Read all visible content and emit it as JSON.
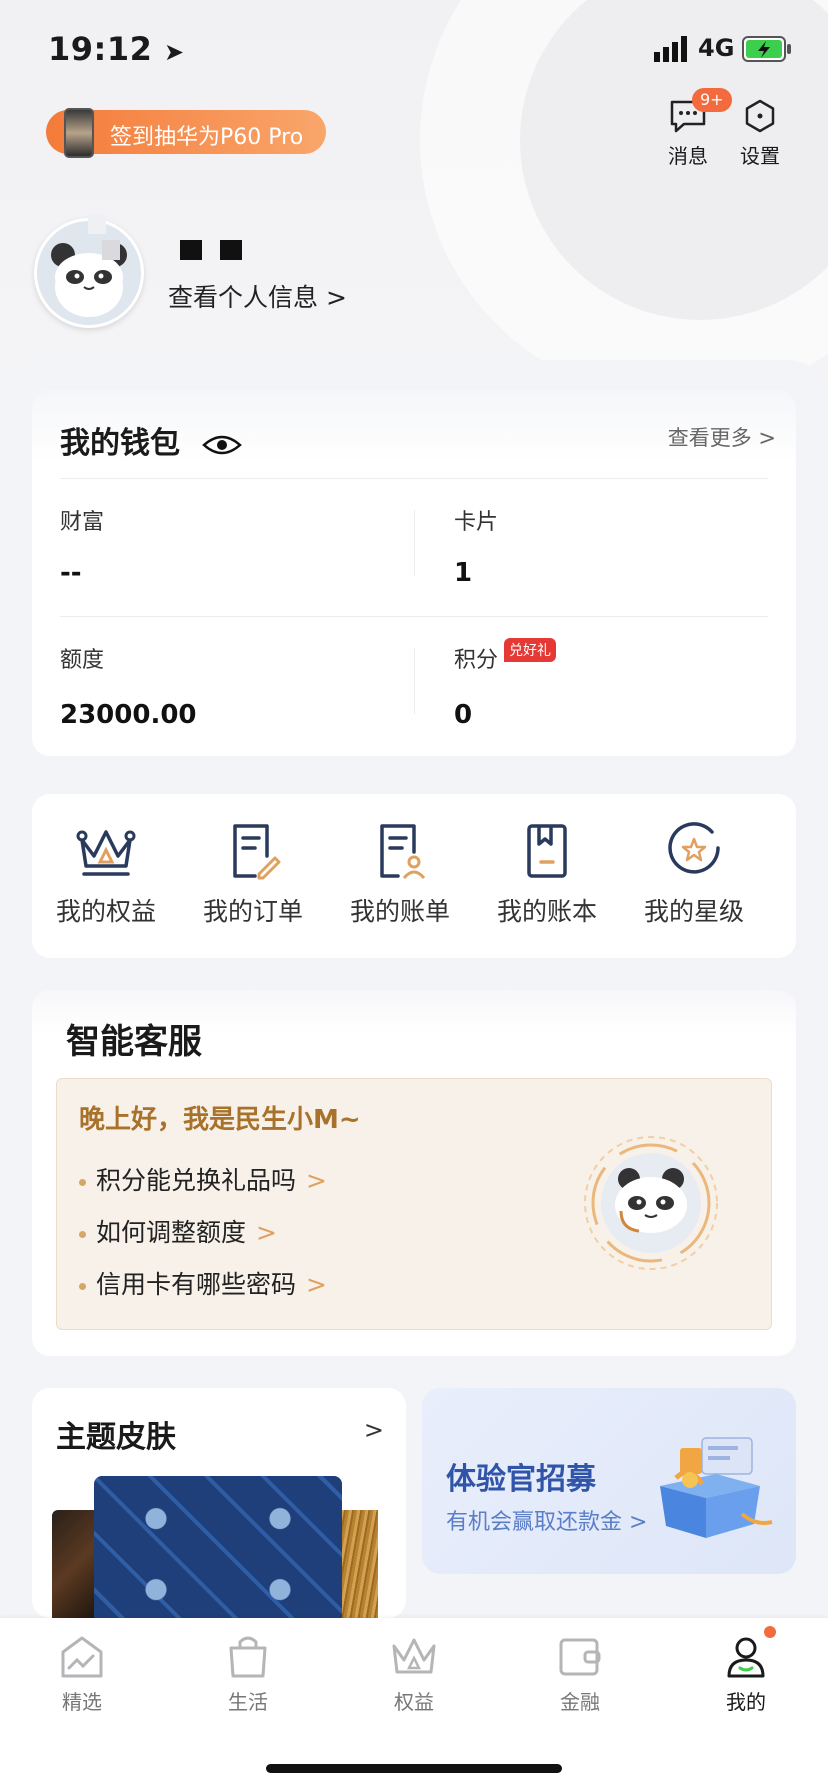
{
  "status_bar": {
    "time": "19:12",
    "network": "4G"
  },
  "promo": {
    "label": "签到抽华为P60 Pro"
  },
  "header": {
    "messages_label": "消息",
    "messages_badge": "9+",
    "settings_label": "设置",
    "view_profile": "查看个人信息 >"
  },
  "wallet": {
    "title": "我的钱包",
    "more": "查看更多 >",
    "items": [
      {
        "label": "财富",
        "value": "--"
      },
      {
        "label": "卡片",
        "value": "1"
      },
      {
        "label": "额度",
        "value": "23000.00"
      },
      {
        "label": "积分",
        "value": "0",
        "badge": "兑好礼"
      }
    ]
  },
  "quick_links": [
    {
      "label": "我的权益",
      "icon": "crown-icon"
    },
    {
      "label": "我的订单",
      "icon": "order-icon"
    },
    {
      "label": "我的账单",
      "icon": "bill-icon"
    },
    {
      "label": "我的账本",
      "icon": "ledger-icon"
    },
    {
      "label": "我的星级",
      "icon": "star-level-icon"
    }
  ],
  "service": {
    "title": "智能客服",
    "greeting": "晚上好，我是民生小M~",
    "questions": [
      "积分能兑换礼品吗",
      "如何调整额度",
      "信用卡有哪些密码"
    ]
  },
  "skin": {
    "title": "主题皮肤",
    "arrow": ">"
  },
  "recruit": {
    "title": "体验官招募",
    "subtitle": "有机会赢取还款金 >"
  },
  "tabs": [
    {
      "label": "精选",
      "icon": "home-icon",
      "active": false
    },
    {
      "label": "生活",
      "icon": "bag-icon",
      "active": false
    },
    {
      "label": "权益",
      "icon": "crown-icon",
      "active": false
    },
    {
      "label": "金融",
      "icon": "wallet-icon",
      "active": false
    },
    {
      "label": "我的",
      "icon": "person-icon",
      "active": true
    }
  ],
  "colors": {
    "accent": "#f47b3a",
    "gold": "#a8722a",
    "navy": "#2a3a5c",
    "recruit_blue": "#2f54a8"
  }
}
